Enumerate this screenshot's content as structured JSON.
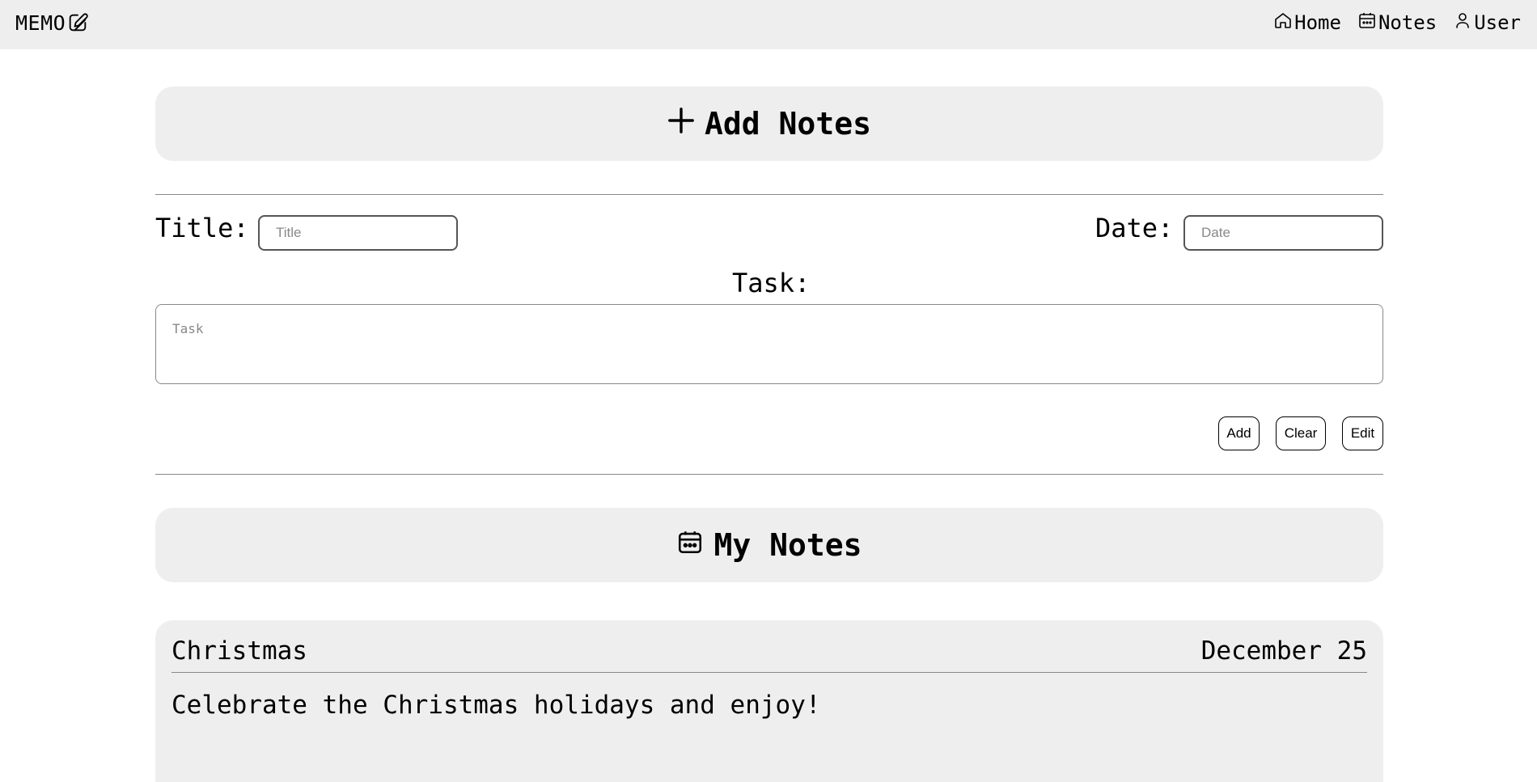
{
  "nav": {
    "brand": "MEMO",
    "brand_icon": "edit-note-icon",
    "links": [
      {
        "label": "Home",
        "icon": "home-icon"
      },
      {
        "label": "Notes",
        "icon": "calendar-icon"
      },
      {
        "label": "User",
        "icon": "user-icon"
      }
    ]
  },
  "add_section": {
    "title": "Add Notes",
    "icon": "plus-icon"
  },
  "form": {
    "title_label": "Title:",
    "title_placeholder": "Title",
    "date_label": "Date:",
    "date_placeholder": "Date",
    "task_label": "Task:",
    "task_placeholder": "Task",
    "buttons": {
      "add": "Add",
      "clear": "Clear",
      "edit": "Edit"
    }
  },
  "notes_section": {
    "title": "My Notes",
    "icon": "calendar-icon"
  },
  "notes": [
    {
      "title": "Christmas",
      "date": "December 25",
      "body": "Celebrate the Christmas holidays and enjoy!"
    }
  ],
  "colors": {
    "panel_bg": "#eeeeee",
    "divider": "#888888",
    "text": "#000000"
  }
}
